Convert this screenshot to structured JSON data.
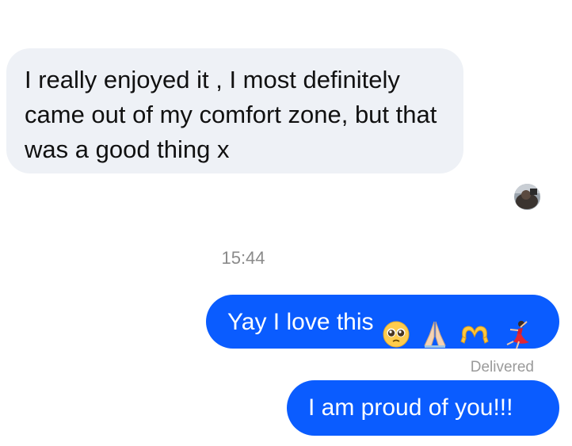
{
  "messages": {
    "incoming": {
      "text": "I really enjoyed it ,  I most definitely came out of my comfort zone, but that was a good thing x"
    },
    "timestamp": "15:44",
    "outgoing": [
      {
        "text": "Yay I love this",
        "emojis": [
          "pleading-face-emoji",
          "folded-hands-emoji",
          "heart-hands-emoji",
          "dancer-emoji"
        ]
      },
      {
        "text": "I am proud of you!!!"
      }
    ],
    "delivery_status": "Delivered"
  },
  "colors": {
    "incoming_bubble": "#eef1f6",
    "outgoing_bubble": "#0a5cff",
    "timestamp_text": "#8a8a8a",
    "status_text": "#9a9a9a"
  }
}
